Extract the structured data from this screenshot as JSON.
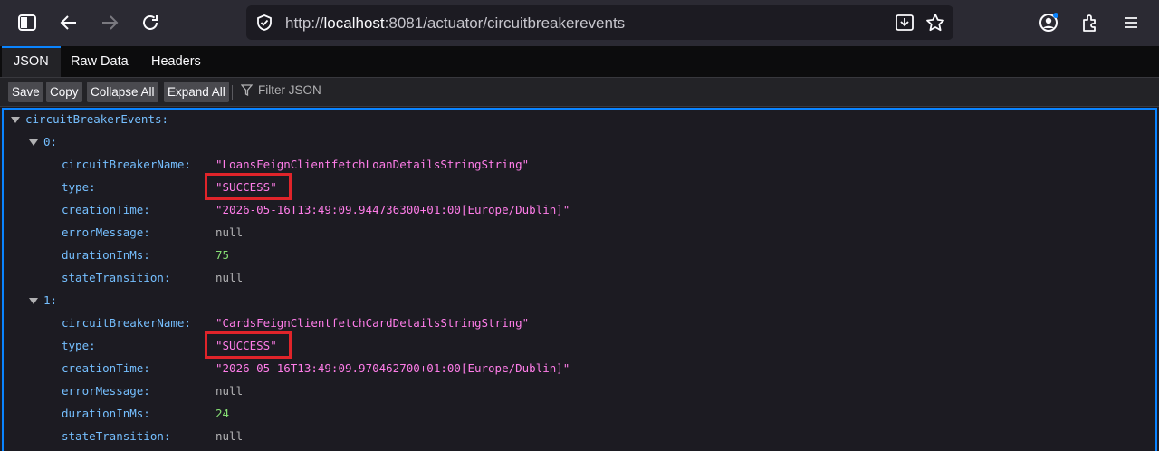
{
  "browser": {
    "url_prefix": "http://",
    "url_host": "localhost",
    "url_rest": ":8081/actuator/circuitbreakerevents"
  },
  "viewer": {
    "tabs": [
      "JSON",
      "Raw Data",
      "Headers"
    ],
    "buttons": [
      "Save",
      "Copy",
      "Collapse All",
      "Expand All"
    ],
    "filter_placeholder": "Filter JSON"
  },
  "json": {
    "root_key": "circuitBreakerEvents:",
    "events": [
      {
        "index": "0:",
        "fields": [
          {
            "key": "circuitBreakerName:",
            "value": "\"LoansFeignClientfetchLoanDetailsStringString\"",
            "kind": "str"
          },
          {
            "key": "type:",
            "value": "\"SUCCESS\"",
            "kind": "str"
          },
          {
            "key": "creationTime:",
            "value": "\"2026-05-16T13:49:09.944736300+01:00[Europe/Dublin]\"",
            "kind": "str"
          },
          {
            "key": "errorMessage:",
            "value": "null",
            "kind": "nul"
          },
          {
            "key": "durationInMs:",
            "value": "75",
            "kind": "num"
          },
          {
            "key": "stateTransition:",
            "value": "null",
            "kind": "nul"
          }
        ]
      },
      {
        "index": "1:",
        "fields": [
          {
            "key": "circuitBreakerName:",
            "value": "\"CardsFeignClientfetchCardDetailsStringString\"",
            "kind": "str"
          },
          {
            "key": "type:",
            "value": "\"SUCCESS\"",
            "kind": "str"
          },
          {
            "key": "creationTime:",
            "value": "\"2026-05-16T13:49:09.970462700+01:00[Europe/Dublin]\"",
            "kind": "str"
          },
          {
            "key": "errorMessage:",
            "value": "null",
            "kind": "nul"
          },
          {
            "key": "durationInMs:",
            "value": "24",
            "kind": "num"
          },
          {
            "key": "stateTransition:",
            "value": "null",
            "kind": "nul"
          }
        ]
      }
    ]
  },
  "colors": {
    "key": "#75bfff",
    "string": "#ff7de9",
    "null": "#b1b1b3",
    "number": "#86de74",
    "highlight": "#e0242a",
    "accent": "#0a84ff"
  }
}
